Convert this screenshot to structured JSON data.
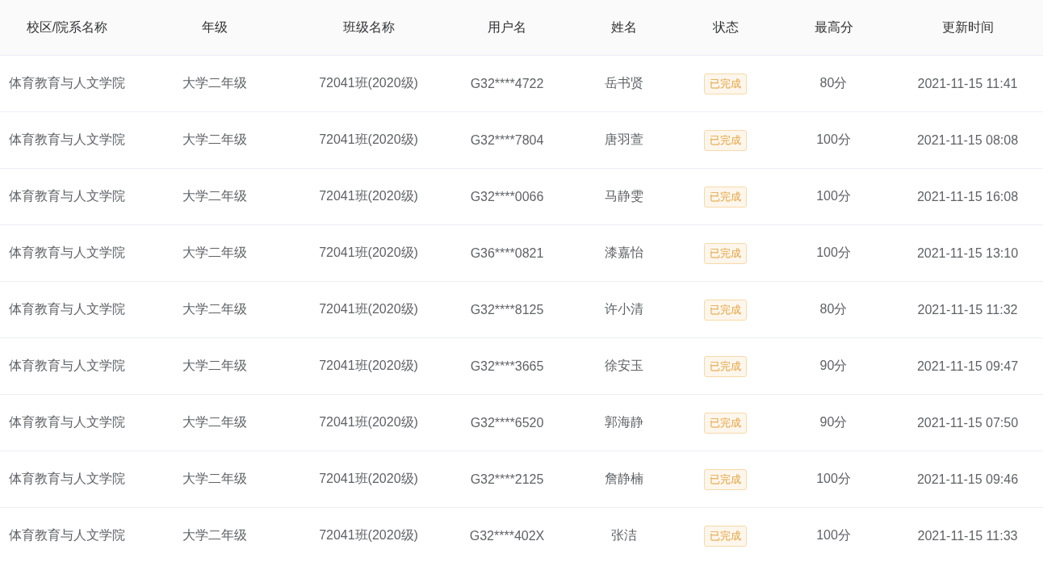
{
  "table": {
    "columns": [
      "校区/院系名称",
      "年级",
      "班级名称",
      "用户名",
      "姓名",
      "状态",
      "最高分",
      "更新时间"
    ],
    "rows": [
      {
        "campus": "体育教育与人文学院",
        "grade": "大学二年级",
        "class_name": "72041班(2020级)",
        "username": "G32****4722",
        "name": "岳书贤",
        "status": "已完成",
        "top_score": "80分",
        "updated": "2021-11-15 11:41"
      },
      {
        "campus": "体育教育与人文学院",
        "grade": "大学二年级",
        "class_name": "72041班(2020级)",
        "username": "G32****7804",
        "name": "唐羽萱",
        "status": "已完成",
        "top_score": "100分",
        "updated": "2021-11-15 08:08"
      },
      {
        "campus": "体育教育与人文学院",
        "grade": "大学二年级",
        "class_name": "72041班(2020级)",
        "username": "G32****0066",
        "name": "马静雯",
        "status": "已完成",
        "top_score": "100分",
        "updated": "2021-11-15 16:08"
      },
      {
        "campus": "体育教育与人文学院",
        "grade": "大学二年级",
        "class_name": "72041班(2020级)",
        "username": "G36****0821",
        "name": "漆嘉怡",
        "status": "已完成",
        "top_score": "100分",
        "updated": "2021-11-15 13:10"
      },
      {
        "campus": "体育教育与人文学院",
        "grade": "大学二年级",
        "class_name": "72041班(2020级)",
        "username": "G32****8125",
        "name": "许小清",
        "status": "已完成",
        "top_score": "80分",
        "updated": "2021-11-15 11:32"
      },
      {
        "campus": "体育教育与人文学院",
        "grade": "大学二年级",
        "class_name": "72041班(2020级)",
        "username": "G32****3665",
        "name": "徐安玉",
        "status": "已完成",
        "top_score": "90分",
        "updated": "2021-11-15 09:47"
      },
      {
        "campus": "体育教育与人文学院",
        "grade": "大学二年级",
        "class_name": "72041班(2020级)",
        "username": "G32****6520",
        "name": "郭海静",
        "status": "已完成",
        "top_score": "90分",
        "updated": "2021-11-15 07:50"
      },
      {
        "campus": "体育教育与人文学院",
        "grade": "大学二年级",
        "class_name": "72041班(2020级)",
        "username": "G32****2125",
        "name": "詹静楠",
        "status": "已完成",
        "top_score": "100分",
        "updated": "2021-11-15 09:46"
      },
      {
        "campus": "体育教育与人文学院",
        "grade": "大学二年级",
        "class_name": "72041班(2020级)",
        "username": "G32****402X",
        "name": "张洁",
        "status": "已完成",
        "top_score": "100分",
        "updated": "2021-11-15 11:33"
      }
    ]
  }
}
